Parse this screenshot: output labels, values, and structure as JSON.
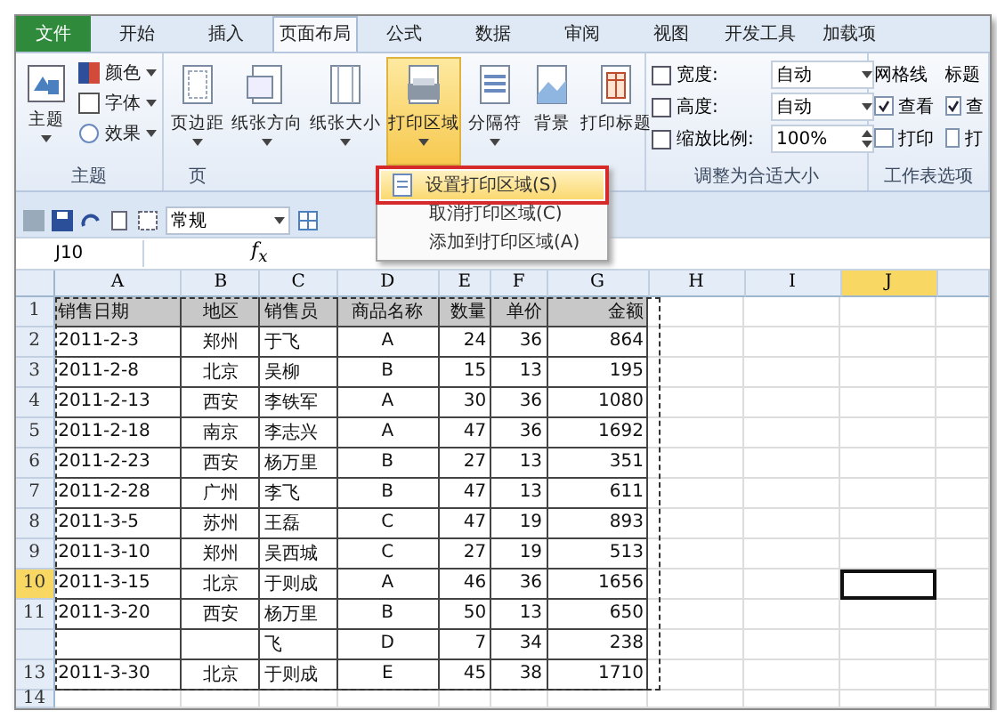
{
  "tabs": [
    {
      "label": "文件",
      "kind": "file",
      "selected": false
    },
    {
      "label": "开始",
      "kind": "tab",
      "selected": false
    },
    {
      "label": "插入",
      "kind": "tab",
      "selected": false
    },
    {
      "label": "页面布局",
      "kind": "tab",
      "selected": true
    },
    {
      "label": "公式",
      "kind": "tab",
      "selected": false
    },
    {
      "label": "数据",
      "kind": "tab",
      "selected": false
    },
    {
      "label": "审阅",
      "kind": "tab",
      "selected": false
    },
    {
      "label": "视图",
      "kind": "tab",
      "selected": false
    },
    {
      "label": "开发工具",
      "kind": "tab",
      "selected": false
    },
    {
      "label": "加载项",
      "kind": "tab",
      "selected": false
    }
  ],
  "ribbon": {
    "theme_group": {
      "big_button": "主题",
      "items": [
        "颜色",
        "字体",
        "效果"
      ],
      "label": "主题"
    },
    "page_setup_group": {
      "buttons": [
        {
          "label": "页边距",
          "selected": false
        },
        {
          "label": "纸张方向",
          "selected": false
        },
        {
          "label": "纸张大小",
          "selected": false
        },
        {
          "label": "打印区域",
          "selected": true
        },
        {
          "label": "分隔符",
          "selected": false
        },
        {
          "label": "背景",
          "selected": false
        },
        {
          "label": "打印标题",
          "selected": false
        }
      ],
      "label": "页"
    },
    "scale_group": {
      "fields": [
        {
          "label": "宽度:",
          "value": "自动"
        },
        {
          "label": "高度:",
          "value": "自动"
        },
        {
          "label": "缩放比例:",
          "value": "100%"
        }
      ],
      "label": "调整为合适大小"
    },
    "sheet_options": {
      "columns": [
        {
          "title": "网格线",
          "options": [
            {
              "label": "查看",
              "checked": true
            },
            {
              "label": "打印",
              "checked": false
            }
          ]
        },
        {
          "title": "标题",
          "options": [
            {
              "label": "查",
              "checked": true
            },
            {
              "label": "打",
              "checked": false
            }
          ]
        }
      ],
      "label": "工作表选项"
    }
  },
  "quick_access": {
    "number_format": "常规"
  },
  "formula_bar": {
    "name_box": "J10",
    "fx": "f$_{x}$"
  },
  "menu": {
    "items": [
      {
        "label": "设置打印区域(S)",
        "selected": true
      },
      {
        "label": "取消打印区域(C)",
        "selected": false
      },
      {
        "label": "添加到打印区域(A)",
        "selected": false
      }
    ]
  },
  "sheet": {
    "columns": [
      {
        "label": "A",
        "selected": false
      },
      {
        "label": "B",
        "selected": false
      },
      {
        "label": "C",
        "selected": false
      },
      {
        "label": "D",
        "selected": false
      },
      {
        "label": "E",
        "selected": false
      },
      {
        "label": "F",
        "selected": false
      },
      {
        "label": "G",
        "selected": false
      },
      {
        "label": "H",
        "selected": false
      },
      {
        "label": "I",
        "selected": false
      },
      {
        "label": "J",
        "selected": true
      }
    ],
    "rows": [
      {
        "number": "1",
        "selected": false,
        "kind": "header",
        "cells": [
          "销售日期",
          "地区",
          "销售员",
          "商品名称",
          "数量",
          "单价",
          "金额"
        ]
      },
      {
        "number": "2",
        "selected": false,
        "kind": "data",
        "cells": [
          "2011-2-3",
          "郑州",
          "于飞",
          "A",
          "24",
          "36",
          "864"
        ]
      },
      {
        "number": "3",
        "selected": false,
        "kind": "data",
        "cells": [
          "2011-2-8",
          "北京",
          "吴柳",
          "B",
          "15",
          "13",
          "195"
        ]
      },
      {
        "number": "4",
        "selected": false,
        "kind": "data",
        "cells": [
          "2011-2-13",
          "西安",
          "李铁军",
          "A",
          "30",
          "36",
          "1080"
        ]
      },
      {
        "number": "5",
        "selected": false,
        "kind": "data",
        "cells": [
          "2011-2-18",
          "南京",
          "李志兴",
          "A",
          "47",
          "36",
          "1692"
        ]
      },
      {
        "number": "6",
        "selected": false,
        "kind": "data",
        "cells": [
          "2011-2-23",
          "西安",
          "杨万里",
          "B",
          "27",
          "13",
          "351"
        ]
      },
      {
        "number": "7",
        "selected": false,
        "kind": "data",
        "cells": [
          "2011-2-28",
          "广州",
          "李飞",
          "B",
          "47",
          "13",
          "611"
        ]
      },
      {
        "number": "8",
        "selected": false,
        "kind": "data",
        "cells": [
          "2011-3-5",
          "苏州",
          "王磊",
          "C",
          "47",
          "19",
          "893"
        ]
      },
      {
        "number": "9",
        "selected": false,
        "kind": "data",
        "cells": [
          "2011-3-10",
          "郑州",
          "吴西城",
          "C",
          "27",
          "19",
          "513"
        ]
      },
      {
        "number": "10",
        "selected": true,
        "kind": "data",
        "cells": [
          "2011-3-15",
          "北京",
          "于则成",
          "A",
          "46",
          "36",
          "1656"
        ]
      },
      {
        "number": "11",
        "selected": false,
        "kind": "data",
        "cells": [
          "2011-3-20",
          "西安",
          "杨万里",
          "B",
          "50",
          "13",
          "650"
        ]
      },
      {
        "number": null,
        "selected": false,
        "kind": "data",
        "cells": [
          null,
          null,
          "飞",
          "D",
          "7",
          "34",
          "238"
        ]
      },
      {
        "number": "13",
        "selected": false,
        "kind": "data",
        "cells": [
          "2011-3-30",
          "北京",
          "于则成",
          "E",
          "45",
          "38",
          "1710"
        ]
      },
      {
        "number": "14",
        "selected": false,
        "kind": "partial"
      }
    ]
  }
}
